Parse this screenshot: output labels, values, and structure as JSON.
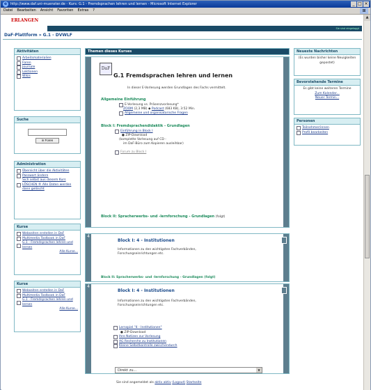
{
  "window": {
    "title": "http://www.daf.uni-muenster.de - Kurs: G.1 - Fremdsprachen lehren und lernen - Microsoft Internet Explorer",
    "controls": [
      "_",
      "□",
      "×"
    ]
  },
  "menu": [
    "Datei",
    "Bearbeiten",
    "Ansicht",
    "Favoriten",
    "Extras",
    "?"
  ],
  "header": {
    "logo": "ERLANGEN",
    "user_info": "Sie sind eingeloggt",
    "breadcrumb": "DaF-Plattform » G.1 - DVWLF"
  },
  "left": {
    "activities": {
      "title": "Aktivitäten",
      "items": [
        "Arbeitsmaterialien",
        "Foren",
        "Journale",
        "Lektionen",
        "Wikis"
      ]
    },
    "search": {
      "title": "Suche",
      "button": "in Foren",
      "value": ""
    },
    "admin": {
      "title": "Administration",
      "items": [
        "Übersicht über die Aktivitäten",
        "Passwort ändern",
        "Sich selbst aus diesem Kurs LÖSCHEN ® Alle Daten werden dann gelöscht"
      ]
    },
    "courses1": {
      "title": "Kurse",
      "items": [
        "Webseiten erstellen in DaF",
        "Multimedia Toolbook in DaF",
        "G.1 - Fremdsprachen lehren und lernen"
      ],
      "more": "Alle Kurse..."
    },
    "courses2": {
      "title": "Kurse",
      "items": [
        "Webseiten erstellen in DaF",
        "Multimedia Toolbook in DaF",
        "G.1 - Fremdsprachen lehren und lernen"
      ],
      "more": "Alle Kurse..."
    }
  },
  "main": {
    "header": "Themen dieses Kurses",
    "course_icon": "DaF",
    "course_title": "G.1 Fremdsprachen lehren und lernen",
    "intro": "In dieser E-Vorlesung werden Grundlagen des Fachs vermittelt.",
    "general": {
      "title": "Allgemeine Einführung",
      "line1": "E-Vorlesung vs. Präsenzvorlesung*",
      "line2a": "ZOOM",
      "line2b": "(2,3 MB) ◆",
      "line2c": "Podcast",
      "line2d": "(683 KB), 3:52 Min.",
      "faq": "Allgemeine und organisatorische Fragen"
    },
    "block1": {
      "title": "Block I: Fremdsprachendidaktik - Grundlagen",
      "items": [
        "Einführung in Block I",
        "ZIP-Download",
        "(komplette Vorlesung auf CD -",
        "im DaF-Büro zum Kopieren ausleihbar)"
      ],
      "forum": "Forum zu Block I"
    },
    "block2": {
      "title": "Block II: Spracherwerbs- und -lernforschung - Grundlagen",
      "suffix": "(folgt)"
    },
    "t4": {
      "title": "Block I: 4 - Institutionen",
      "text": "Informationen zu den wichtigsten Fachverbänden, Forschungseinrichtungen etc.",
      "overlap": "Block II: Spracherwerbs- und -lernforschung - Grundlagen (folgt)"
    },
    "t5": {
      "title": "Block I: 4 - Institutionen",
      "text": "Informationen zu den wichtigsten Fachverbänden, Forschungseinrichtungen etc.",
      "lernspiel": "Lernspiel \"4 - Institutionen\"",
      "zip": "ZIP-Download",
      "links": [
        "Ihre Notizen zur Vorlesung",
        "AG Recherche zu Institutionen",
        "Kleine Selbstkontrolle zwischendurch"
      ]
    },
    "numbers": [
      "4",
      "4"
    ]
  },
  "right": {
    "news": {
      "title": "Neueste Nachrichten",
      "text": "(Es wurden bisher keine Neuigkeiten gepostet)"
    },
    "events": {
      "title": "Bevorstehende Termine",
      "text": "Es gibt keine weiteren Termine",
      "links": [
        "Zum Kalender...",
        "Neuer Termin..."
      ]
    },
    "people": {
      "title": "Personen",
      "items": [
        "Teilnehmer/innen",
        "Profil bearbeiten"
      ]
    }
  },
  "footer": {
    "select": "Direkt zu...",
    "login_prefix": "Sie sind angemeldet als",
    "user": "aktiv aktiv",
    "logout": "(Logout)",
    "home": "Startseite"
  }
}
